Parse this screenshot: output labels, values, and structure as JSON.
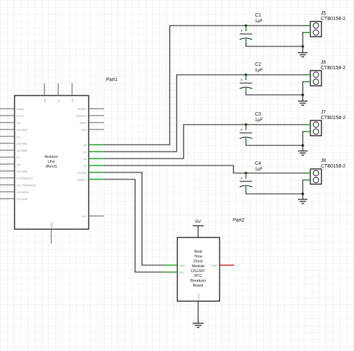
{
  "arduino": {
    "ref": "Part1",
    "name_lines": [
      "Arduino",
      "Uno",
      "(Rev3)"
    ],
    "top_pins": [
      "VIN",
      "5V",
      "3V3"
    ],
    "bottom_pin": "GND",
    "left_pins": [
      "D0/RX",
      "D1/TX",
      "D2",
      "D3 PWM",
      "D4",
      "D5 PWM",
      "D6 PWM",
      "D7",
      "D8",
      "D9 PWM",
      "D10 PWM/SS",
      "D11 PWM/MOSI",
      "D12/MISO",
      "D13/SCK"
    ],
    "right_pins_top": [
      "RESET",
      "RESET2",
      "AREF",
      "ioref"
    ],
    "right_pins_analog": [
      "A0",
      "A1",
      "A2",
      "A3",
      "A4/SDA",
      "A5/SCL"
    ],
    "right_pin_bottom": "N/C"
  },
  "rtc": {
    "ref": "Part2",
    "name_lines": [
      "Real",
      "Time",
      "Clock",
      "Module",
      "DS1307",
      "RTC",
      "Breakout",
      "Board"
    ],
    "power_label": "5V",
    "pins": {
      "sda": "SDA",
      "scl": "SCL",
      "sqw": "SQW",
      "gnd": "GND"
    }
  },
  "capacitors": [
    {
      "ref": "C1",
      "value": "1µF"
    },
    {
      "ref": "C2",
      "value": "1µF"
    },
    {
      "ref": "C3",
      "value": "1µF"
    },
    {
      "ref": "C4",
      "value": "1µF"
    }
  ],
  "connectors": [
    {
      "ref": "J5",
      "part": "CTB0158-2"
    },
    {
      "ref": "J6",
      "part": "CTB0158-2"
    },
    {
      "ref": "J7",
      "part": "CTB0158-2"
    },
    {
      "ref": "J8",
      "part": "CTB0158-2"
    }
  ],
  "colors": {
    "wire": "#111111",
    "pin_end": "#1fa01f",
    "sqw_pin": "#cc2222",
    "grid": "#c9d6ea"
  }
}
